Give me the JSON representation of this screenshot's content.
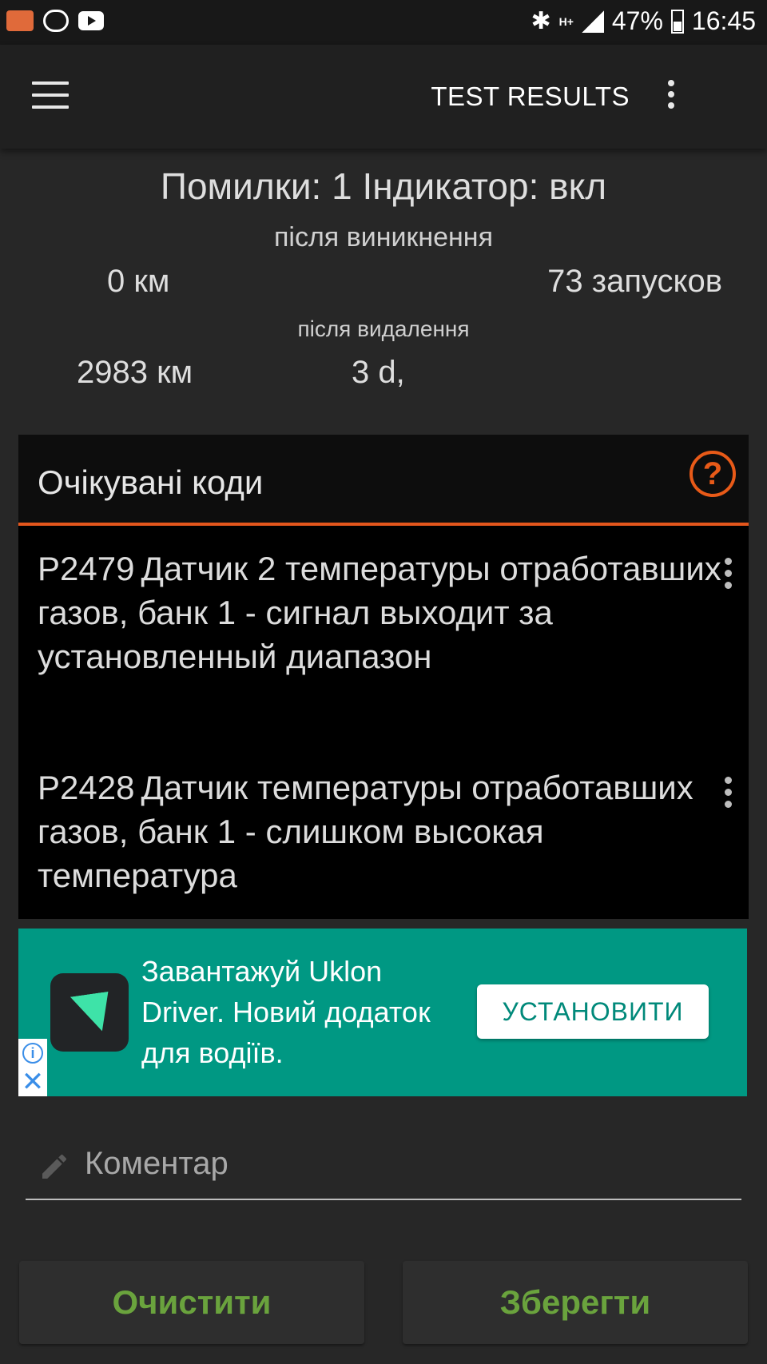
{
  "status_bar": {
    "battery": "47%",
    "time": "16:45",
    "network": "H+"
  },
  "app_bar": {
    "title": "TEST RESULTS"
  },
  "summary": {
    "errors_line": "Помилки: 1 Індикатор: вкл",
    "after_occurrence_label": "після виникнення",
    "distance_since_occurrence": "0 км",
    "starts": "73 запусков",
    "after_deletion_label": "після видалення",
    "distance_since_deletion": "2983 км",
    "days_since_deletion": "3 d,"
  },
  "pending_codes": {
    "title": "Очікувані коди",
    "items": [
      {
        "code": "P2479",
        "description": "Датчик 2 температуры отработавших газов, банк 1 - сигнал выходит за установленный диапазон"
      },
      {
        "code": "P2428",
        "description": "Датчик температуры отработавших газов, банк 1 - слишком высокая температура"
      }
    ]
  },
  "ad": {
    "text": "Завантажуй Uklon Driver. Новий додаток для водіїв.",
    "button_label": "УСТАНОВИТИ",
    "info_glyph": "i",
    "close_glyph": "✕"
  },
  "comment": {
    "placeholder": "Коментар"
  },
  "buttons": {
    "clear_label": "Очистити",
    "save_label": "Зберегти"
  },
  "colors": {
    "accent_orange": "#e3561c",
    "ad_green": "#009883",
    "button_text_green": "#6aa33d"
  }
}
